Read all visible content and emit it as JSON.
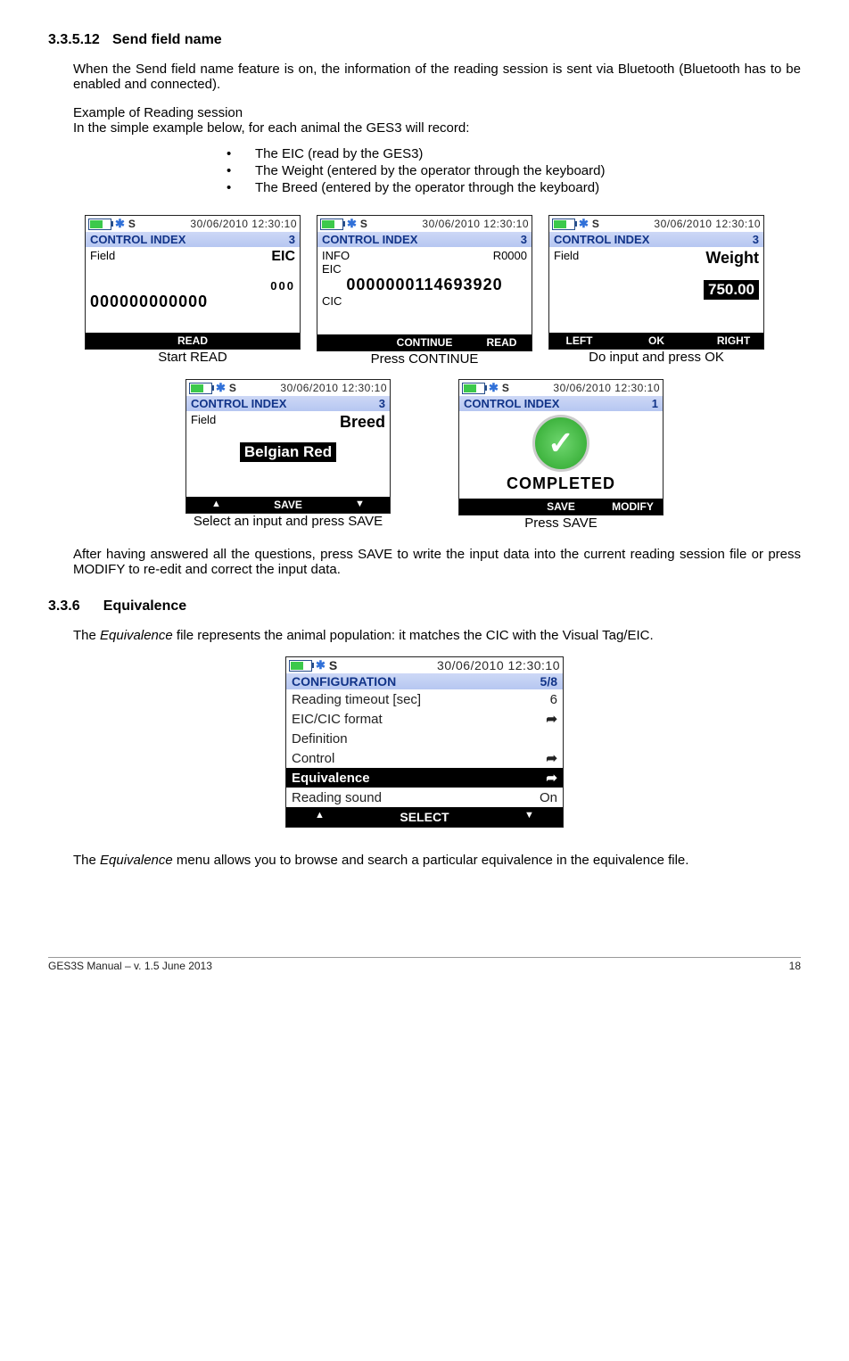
{
  "section1": {
    "number": "3.3.5.12",
    "title": "Send field name",
    "para1": "When the Send field name feature is on, the information of the reading session is sent via Bluetooth (Bluetooth has to be enabled and connected).",
    "exampleTitle": "Example of Reading session",
    "exampleIntro": "In the simple example below, for each animal the GES3 will record:",
    "bullets": [
      "The EIC (read by the GES3)",
      "The Weight (entered by the operator through the keyboard)",
      "The Breed (entered by the operator through the keyboard)"
    ],
    "row1": {
      "s1": {
        "datetime": "30/06/2010  12:30:10",
        "s": "S",
        "ctrl": "CONTROL INDEX",
        "ctrlVal": "3",
        "fieldLabel": "Field",
        "fieldVal": "EIC",
        "v000": "000",
        "long": "000000000000",
        "soft": {
          "c": "READ"
        },
        "caption": "Start READ"
      },
      "s2": {
        "datetime": "30/06/2010  12:30:10",
        "s": "S",
        "ctrl": "CONTROL INDEX",
        "ctrlVal": "3",
        "infoLabel": "INFO",
        "infoVal": "R0000",
        "eicLabel": "EIC",
        "eicVal": "0000000114693920",
        "cicLabel": "CIC",
        "soft": {
          "c": "CONTINUE",
          "r": "READ"
        },
        "caption": "Press CONTINUE"
      },
      "s3": {
        "datetime": "30/06/2010  12:30:10",
        "s": "S",
        "ctrl": "CONTROL INDEX",
        "ctrlVal": "3",
        "fieldLabel": "Field",
        "fieldVal": "Weight",
        "value": "750.00",
        "soft": {
          "l": "LEFT",
          "c": "OK",
          "r": "RIGHT"
        },
        "caption": "Do input and press OK"
      }
    },
    "row2": {
      "s4": {
        "datetime": "30/06/2010  12:30:10",
        "s": "S",
        "ctrl": "CONTROL INDEX",
        "ctrlVal": "3",
        "fieldLabel": "Field",
        "fieldVal": "Breed",
        "value": "Belgian Red",
        "soft": {
          "l": "▲",
          "c": "SAVE",
          "r": "▼"
        },
        "caption": "Select an input and press SAVE"
      },
      "s5": {
        "datetime": "30/06/2010  12:30:10",
        "s": "S",
        "ctrl": "CONTROL INDEX",
        "ctrlVal": "1",
        "completed": "COMPLETED",
        "soft": {
          "c": "SAVE",
          "r": "MODIFY"
        },
        "caption": "Press SAVE"
      }
    },
    "para2": "After having answered all the questions, press SAVE to write the input data into the current reading session file or press MODIFY to re-edit and correct the input data."
  },
  "section2": {
    "number": "3.3.6",
    "title": "Equivalence",
    "para1a": "The ",
    "para1b": "Equivalence",
    "para1c": " file represents the animal population: it matches the CIC with the Visual Tag/EIC.",
    "screen": {
      "datetime": "30/06/2010  12:30:10",
      "s": "S",
      "cfg": "CONFIGURATION",
      "cfgVal": "5/8",
      "rows": [
        {
          "label": "Reading timeout [sec]",
          "val": "6"
        },
        {
          "label": "EIC/CIC format",
          "val": "➦"
        },
        {
          "label": "Definition",
          "val": ""
        },
        {
          "label": "Control",
          "val": "➦"
        },
        {
          "label": "Equivalence",
          "val": "➦",
          "sel": true
        },
        {
          "label": "Reading sound",
          "val": "On"
        }
      ],
      "soft": {
        "l": "▲",
        "c": "SELECT",
        "r": "▼"
      }
    },
    "para2a": "The ",
    "para2b": "Equivalence",
    "para2c": " menu allows you to browse and search a particular equivalence in the equivalence file."
  },
  "footer": {
    "left": "GES3S Manual – v. 1.5  June 2013",
    "right": "18"
  }
}
